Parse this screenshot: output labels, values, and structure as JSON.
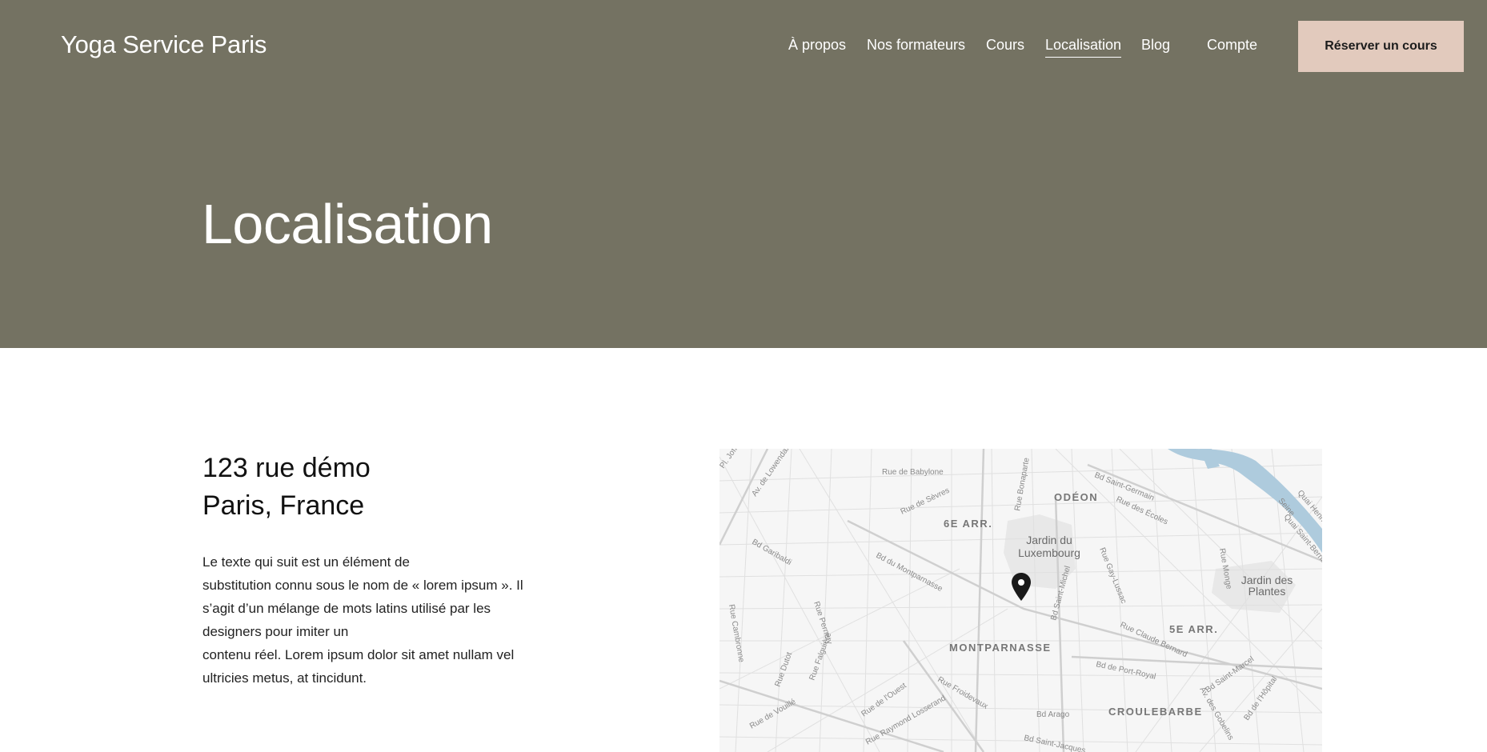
{
  "header": {
    "brand": "Yoga Service Paris",
    "nav": [
      {
        "label": "À propos",
        "active": false
      },
      {
        "label": "Nos formateurs",
        "active": false
      },
      {
        "label": "Cours",
        "active": false
      },
      {
        "label": "Localisation",
        "active": true
      },
      {
        "label": "Blog",
        "active": false
      },
      {
        "label": "Compte",
        "active": false
      }
    ],
    "cta_label": "Réserver un cours"
  },
  "hero": {
    "title": "Localisation"
  },
  "location": {
    "address_lines": [
      "123 rue démo",
      "Paris, France"
    ],
    "description_lines": [
      "Le texte qui suit est un élément de",
      "substitution connu sous le nom de « lorem ipsum ». Il",
      "s’agit d’un mélange de mots latins utilisé par les",
      "designers pour imiter un",
      "contenu réel. Lorem ipsum dolor sit amet nullam vel",
      "ultricies metus, at tincidunt."
    ]
  },
  "map": {
    "districts": [
      "6E ARR.",
      "5E ARR.",
      "ODÉON",
      "MONTPARNASSE",
      "CROULEBARBE"
    ],
    "parks": [
      [
        "Jardin du",
        "Luxembourg"
      ],
      [
        "Jardin des",
        "Plantes"
      ]
    ],
    "streets": [
      "Rue de Babylone",
      "Bd Saint-Germain",
      "Rue des Écoles",
      "Rue de Sèvres",
      "Rue Bonaparte",
      "Bd Garibaldi",
      "Bd du Montparnasse",
      "Bd Saint-Michel",
      "Rue Gay-Lussac",
      "Rue Claude Bernard",
      "Bd de Port-Royal",
      "Bd Arago",
      "Rue Froidevaux",
      "Rue de l'Ouest",
      "Bd Saint-Marcel",
      "Rue Dutot",
      "Quai Saint-Bernard",
      "Rue Cambronne",
      "Rue Falguière",
      "Rue Raymond Losserand",
      "Rue de Vouillé",
      "Bd Saint-Jacques",
      "Av. des Gobelins",
      "Bd de l'Hôpital",
      "Rue Monge",
      "Rue Pernety",
      "Av. de Lowendal",
      "Pl. Joffre",
      "Seine",
      "Quai Henri IV"
    ],
    "marker_icon": "map-pin-icon",
    "colors": {
      "water": "#a9c8dc",
      "roads": "#d6d6d6",
      "park": "#e6e6e6"
    }
  },
  "colors": {
    "hero_bg": "#747262",
    "cta_bg": "#e2cabd",
    "text_dark": "#1c1c1c"
  }
}
